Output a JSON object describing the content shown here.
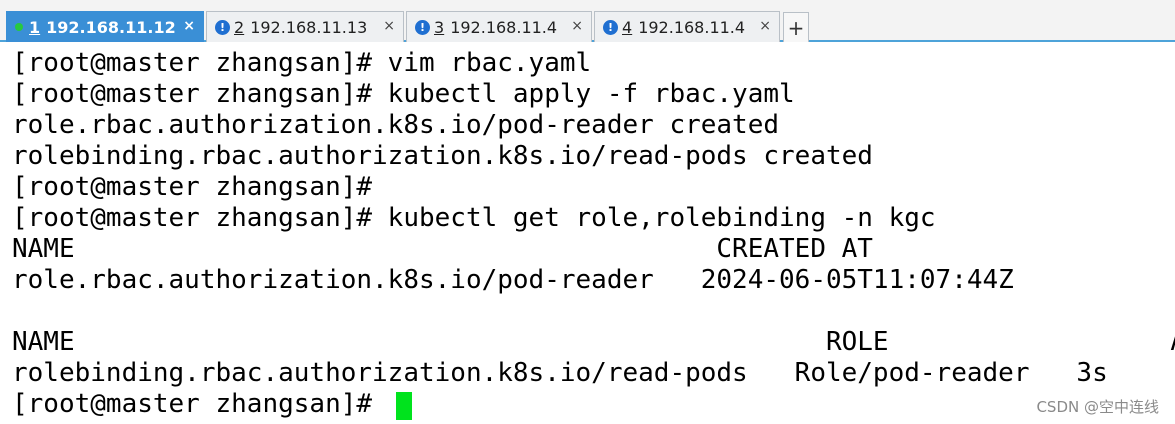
{
  "tabs": [
    {
      "number": "1",
      "label": "192.168.11.12",
      "active": true,
      "status": "connected-dot",
      "close": "×"
    },
    {
      "number": "2",
      "label": "192.168.11.13",
      "active": false,
      "status": "warning-icon",
      "close": "×"
    },
    {
      "number": "3",
      "label": "192.168.11.4",
      "active": false,
      "status": "warning-icon",
      "close": "×"
    },
    {
      "number": "4",
      "label": "192.168.11.4",
      "active": false,
      "status": "warning-icon",
      "close": "×"
    }
  ],
  "new_tab_label": "+",
  "warning_glyph": "!",
  "terminal": {
    "lines": [
      "[root@master zhangsan]# vim rbac.yaml",
      "[root@master zhangsan]# kubectl apply -f rbac.yaml",
      "role.rbac.authorization.k8s.io/pod-reader created",
      "rolebinding.rbac.authorization.k8s.io/read-pods created",
      "[root@master zhangsan]#",
      "[root@master zhangsan]# kubectl get role,rolebinding -n kgc",
      "NAME                                         CREATED AT",
      "role.rbac.authorization.k8s.io/pod-reader   2024-06-05T11:07:44Z",
      "",
      "NAME                                                ROLE                  AGE",
      "rolebinding.rbac.authorization.k8s.io/read-pods   Role/pod-reader   3s",
      "[root@master zhangsan]# "
    ],
    "cursor_color": "#00e31d"
  },
  "watermark": "CSDN @空中连线",
  "colors": {
    "active_tab": "#3a8fd6",
    "tab_border": "#b9c0c7",
    "accent_line": "#4ea3d9",
    "warning": "#1f6fd1",
    "connected": "#27c93f"
  }
}
